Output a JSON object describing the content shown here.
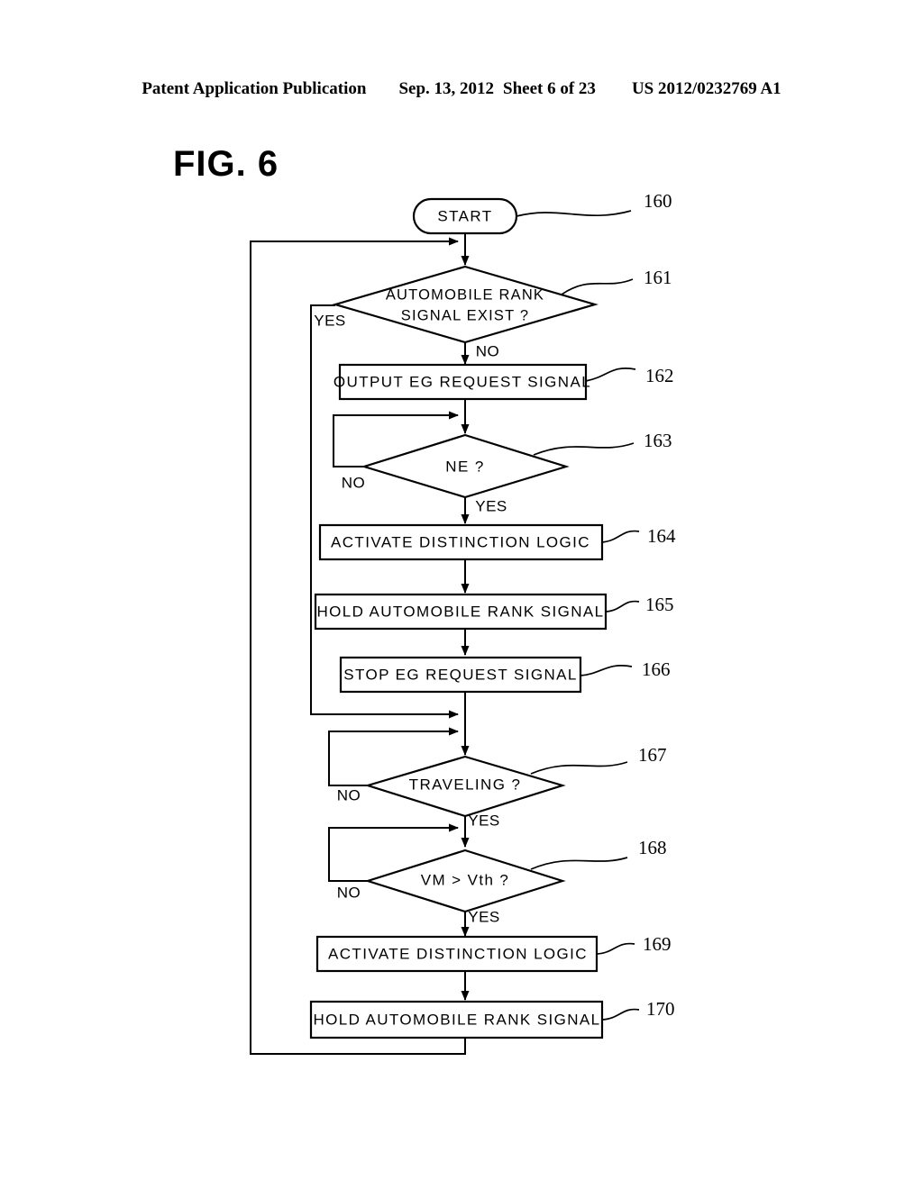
{
  "header": {
    "publication": "Patent Application Publication",
    "date": "Sep. 13, 2012",
    "sheet": "Sheet 6 of 23",
    "patent_number": "US 2012/0232769 A1"
  },
  "figure": {
    "title": "FIG. 6"
  },
  "nodes": {
    "start": {
      "label": "START",
      "ref": "160",
      "type": "terminal"
    },
    "d161": {
      "label1": "AUTOMOBILE RANK",
      "label2": "SIGNAL EXIST ?",
      "ref": "161",
      "type": "decision"
    },
    "p162": {
      "label": "OUTPUT EG REQUEST SIGNAL",
      "ref": "162",
      "type": "process"
    },
    "d163": {
      "label": "NE ?",
      "ref": "163",
      "type": "decision"
    },
    "p164": {
      "label": "ACTIVATE DISTINCTION LOGIC",
      "ref": "164",
      "type": "process"
    },
    "p165": {
      "label": "HOLD AUTOMOBILE RANK SIGNAL",
      "ref": "165",
      "type": "process"
    },
    "p166": {
      "label": "STOP EG REQUEST SIGNAL",
      "ref": "166",
      "type": "process"
    },
    "d167": {
      "label": "TRAVELING ?",
      "ref": "167",
      "type": "decision"
    },
    "d168": {
      "label": "VM > Vth ?",
      "ref": "168",
      "type": "decision"
    },
    "p169": {
      "label": "ACTIVATE DISTINCTION LOGIC",
      "ref": "169",
      "type": "process"
    },
    "p170": {
      "label": "HOLD AUTOMOBILE RANK SIGNAL",
      "ref": "170",
      "type": "process"
    }
  },
  "edge_labels": {
    "e161_yes": "YES",
    "e161_no": "NO",
    "e163_no": "NO",
    "e163_yes": "YES",
    "e167_no": "NO",
    "e167_yes": "YES",
    "e168_no": "NO",
    "e168_yes": "YES"
  },
  "colors": {
    "ink": "#000000",
    "paper": "#ffffff"
  }
}
